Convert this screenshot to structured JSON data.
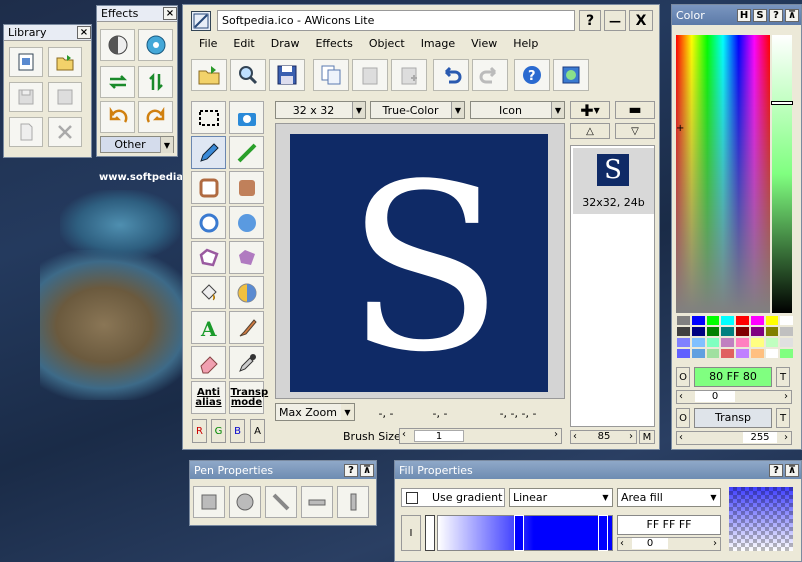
{
  "desktop": {
    "watermark": "www.softpedia.com"
  },
  "library": {
    "title": "Library",
    "close": "×"
  },
  "effects": {
    "title": "Effects",
    "close": "×",
    "other": "Other"
  },
  "main": {
    "title": "Softpedia.ico - AWicons Lite",
    "help_btn": "?",
    "min_btn": "—",
    "close_btn": "X",
    "menu": [
      "File",
      "Edit",
      "Draw",
      "Effects",
      "Object",
      "Image",
      "View",
      "Help"
    ],
    "size_combo": "32 x 32",
    "color_combo": "True-Color",
    "type_combo": "Icon",
    "zoom_combo": "Max Zoom",
    "status": [
      "-, -",
      "-, -",
      "-, -, -, -"
    ],
    "brush_label": "Brush Size",
    "brush_value": "1",
    "anti_alias": "Anti alias",
    "transp_mode": "Transp mode",
    "channels": [
      "R",
      "G",
      "B",
      "A"
    ],
    "thumb_label": "32x32, 24b",
    "thumb_letter": "S",
    "canvas_letter": "S",
    "right_value": "85",
    "right_m": "M"
  },
  "color": {
    "title": "Color",
    "h": "H",
    "s": "S",
    "help": "?",
    "pin": "⊼",
    "o_label": "O",
    "hex": "80 FF 80",
    "t_label": "T",
    "slider1": "0",
    "o2_label": "O",
    "transp": "Transp",
    "t2_label": "T",
    "slider2": "255",
    "palette": [
      "#808080",
      "#0000ff",
      "#00ff00",
      "#00ffff",
      "#ff0000",
      "#ff00ff",
      "#ffff00",
      "#ffffff",
      "#404040",
      "#000080",
      "#008000",
      "#008080",
      "#800000",
      "#800080",
      "#808000",
      "#c0c0c0",
      "#8080ff",
      "#80c0ff",
      "#80ffc0",
      "#c080c0",
      "#ff80c0",
      "#ffff80",
      "#c0ffc0",
      "#e0e0e0",
      "#6060ff",
      "#60a0e0",
      "#a0e0a0",
      "#e06060",
      "#c080ff",
      "#ffc080",
      "#ffffff",
      "#80ff80"
    ],
    "accent": "#80ff80"
  },
  "pen": {
    "title": "Pen Properties",
    "help": "?",
    "pin": "⊼"
  },
  "fill": {
    "title": "Fill Properties",
    "help": "?",
    "pin": "⊼",
    "use_gradient": "Use gradient",
    "gradient_type": "Linear",
    "fill_type": "Area fill",
    "i_label": "I",
    "hex": "FF FF FF",
    "slider": "0"
  }
}
